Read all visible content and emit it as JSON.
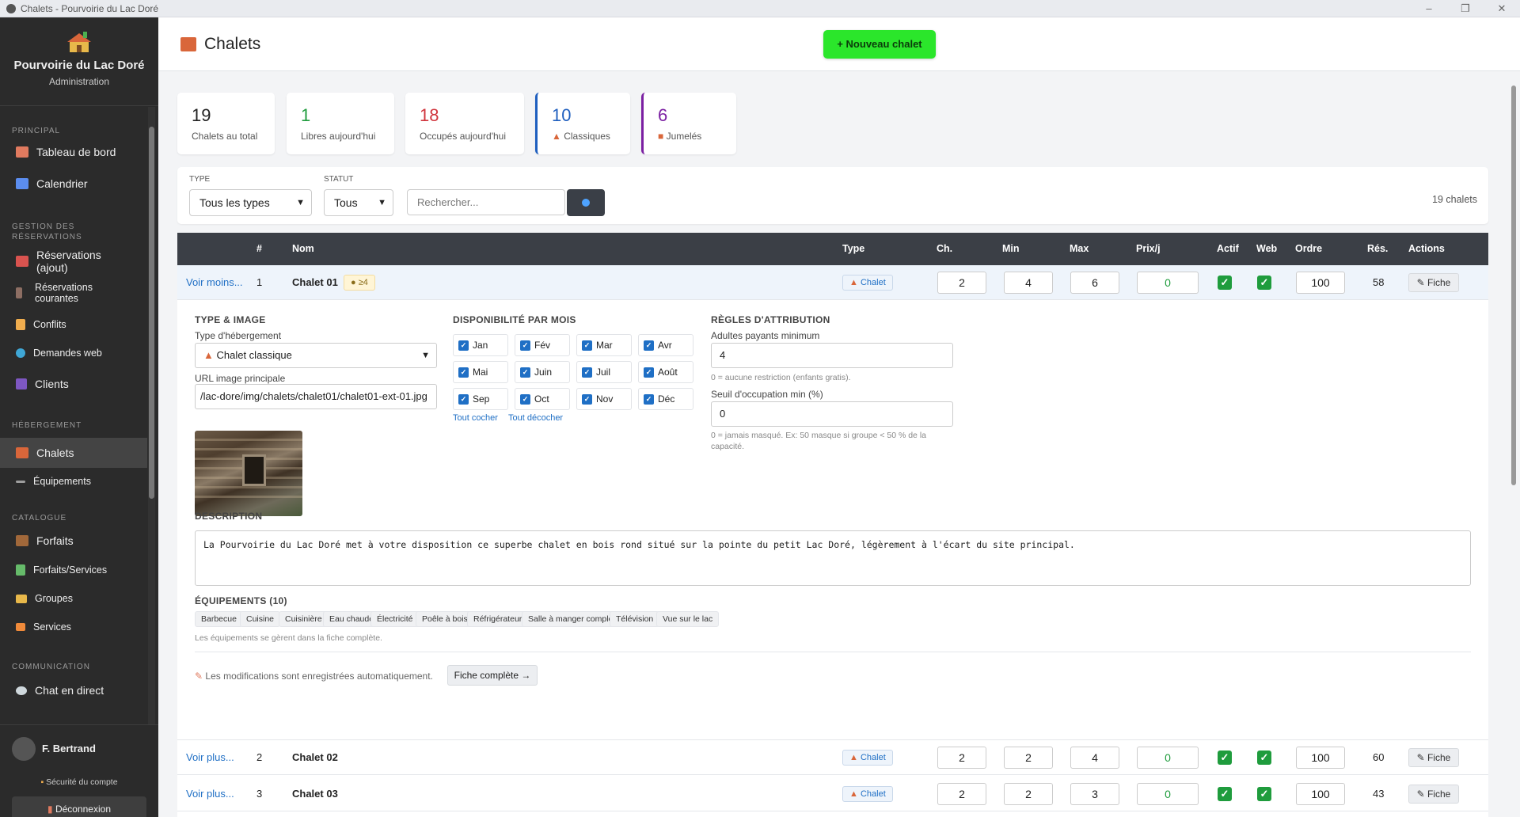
{
  "window": {
    "title": "Chalets - Pourvoirie du Lac Doré",
    "controls": [
      "–",
      "❐",
      "✕"
    ]
  },
  "sidebar": {
    "brand": "Pourvoirie du Lac Doré",
    "brand_sub": "Administration",
    "sections": {
      "principal": "PRINCIPAL",
      "gestion": "GESTION DES RÉSERVATIONS",
      "hebergement": "HÉBERGEMENT",
      "catalogue": "CATALOGUE",
      "communication": "COMMUNICATION"
    },
    "items": {
      "tableau": "Tableau de bord",
      "calendrier": "Calendrier",
      "res_ajout": "Réservations (ajout)",
      "res_courantes": "Réservations courantes",
      "conflits": "Conflits",
      "demandes": "Demandes web",
      "clients": "Clients",
      "chalets": "Chalets",
      "equipements": "Équipements",
      "forfaits": "Forfaits",
      "forfaits_services": "Forfaits/Services",
      "groupes": "Groupes",
      "services": "Services",
      "chat": "Chat en direct"
    },
    "user": "F. Bertrand",
    "security": "Sécurité du compte",
    "logout": "Déconnexion"
  },
  "header": {
    "title": "Chalets",
    "new_button": "+ Nouveau chalet"
  },
  "stats": [
    {
      "value": "19",
      "label": "Chalets au total",
      "color": "#222222"
    },
    {
      "value": "1",
      "label": "Libres aujourd'hui",
      "color": "#1f9c3d"
    },
    {
      "value": "18",
      "label": "Occupés aujourd'hui",
      "color": "#d0343c"
    },
    {
      "value": "10",
      "label": "Classiques",
      "color": "#1f5fbf"
    },
    {
      "value": "6",
      "label": "Jumelés",
      "color": "#7b1fa2"
    }
  ],
  "filters": {
    "type_label": "TYPE",
    "type_value": "Tous les types",
    "statut_label": "STATUT",
    "statut_value": "Tous",
    "search_placeholder": "Rechercher...",
    "count": "19 chalets"
  },
  "table": {
    "headers": {
      "num": "#",
      "nom": "Nom",
      "type": "Type",
      "ch": "Ch.",
      "min": "Min",
      "max": "Max",
      "prix": "Prix/j",
      "actif": "Actif",
      "web": "Web",
      "ordre": "Ordre",
      "res": "Rés.",
      "actions": "Actions"
    },
    "rows": [
      {
        "toggle": "Voir moins...",
        "num": "1",
        "name": "Chalet 01",
        "tag": "≥4",
        "type": "Chalet",
        "ch": "2",
        "min": "4",
        "max": "6",
        "prix": "0",
        "ordre": "100",
        "res": "58",
        "action": "✎ Fiche"
      },
      {
        "toggle": "Voir plus...",
        "num": "2",
        "name": "Chalet 02",
        "type": "Chalet",
        "ch": "2",
        "min": "2",
        "max": "4",
        "prix": "0",
        "ordre": "100",
        "res": "60",
        "action": "✎ Fiche"
      },
      {
        "toggle": "Voir plus...",
        "num": "3",
        "name": "Chalet 03",
        "type": "Chalet",
        "ch": "2",
        "min": "2",
        "max": "3",
        "prix": "0",
        "ordre": "100",
        "res": "43",
        "action": "✎ Fiche"
      }
    ]
  },
  "detail": {
    "type_image_title": "TYPE & IMAGE",
    "type_label": "Type d'hébergement",
    "type_value": "Chalet classique",
    "url_label": "URL image principale",
    "url_value": "/lac-dore/img/chalets/chalet01/chalet01-ext-01.jpg",
    "dispo_title": "DISPONIBILITÉ PAR MOIS",
    "months": [
      "Jan",
      "Fév",
      "Mar",
      "Avr",
      "Mai",
      "Juin",
      "Juil",
      "Août",
      "Sep",
      "Oct",
      "Nov",
      "Déc"
    ],
    "check_all": "Tout cocher",
    "uncheck_all": "Tout décocher",
    "regles_title": "RÈGLES D'ATTRIBUTION",
    "adultes_label": "Adultes payants minimum",
    "adultes_value": "4",
    "adultes_hint": "0 = aucune restriction (enfants gratis).",
    "seuil_label": "Seuil d'occupation min (%)",
    "seuil_value": "0",
    "seuil_hint": "0 = jamais masqué. Ex: 50 masque si groupe < 50 % de la capacité.",
    "desc_title": "DESCRIPTION",
    "desc_value": "La Pourvoirie du Lac Doré met à votre disposition ce superbe chalet en bois rond situé sur la pointe du petit Lac Doré, légèrement à l'écart du site principal.",
    "equip_title": "ÉQUIPEMENTS (10)",
    "equipements": [
      "Barbecue",
      "Cuisine",
      "Cuisinière",
      "Eau chaude",
      "Électricité",
      "Poêle à bois",
      "Réfrigérateur",
      "Salle à manger complète",
      "Télévision",
      "Vue sur le lac"
    ],
    "equip_hint": "Les équipements se gèrent dans la fiche complète.",
    "autosave": "Les modifications sont enregistrées automatiquement.",
    "full_button": "Fiche complète →"
  }
}
